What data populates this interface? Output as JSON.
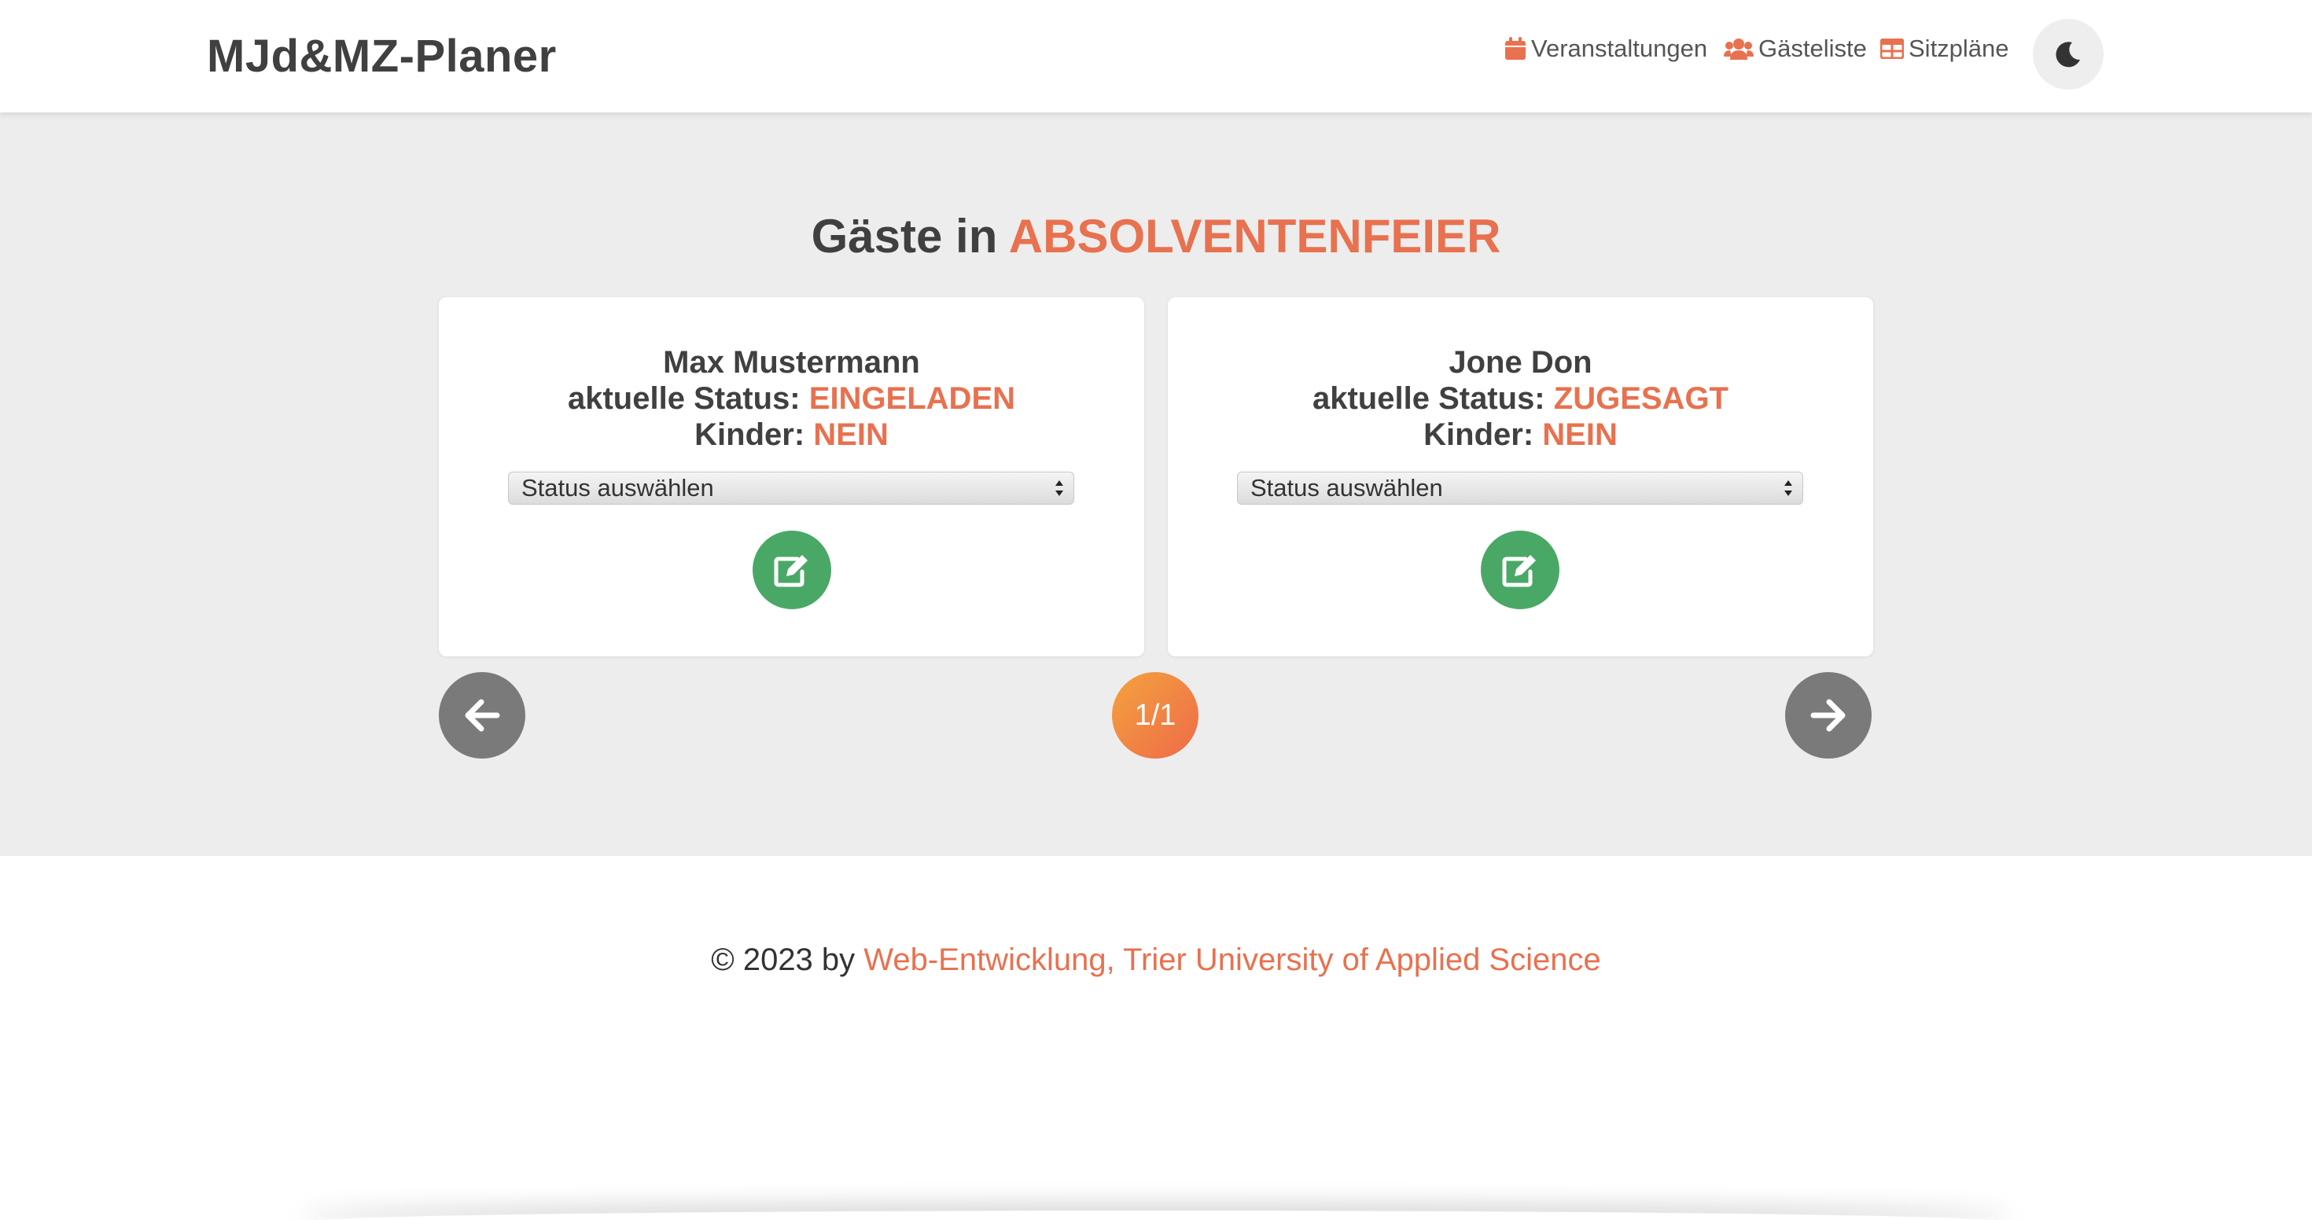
{
  "header": {
    "brand": "MJd&MZ-Planer",
    "nav": {
      "events": "Veranstaltungen",
      "guests": "Gästeliste",
      "seating": "Sitzpläne"
    },
    "icons": [
      "calendar-icon",
      "users-icon",
      "table-icon",
      "moon-icon"
    ]
  },
  "main": {
    "title_prefix": "Gäste in",
    "title_event": "ABSOLVENTENFEIER",
    "guests": [
      {
        "name": "Max Mustermann",
        "status_label": "aktuelle Status:",
        "status": "EINGELADEN",
        "children_label": "Kinder:",
        "children": "NEIN",
        "select_value": "Status auswählen"
      },
      {
        "name": "Jone Don",
        "status_label": "aktuelle Status:",
        "status": "ZUGESAGT",
        "children_label": "Kinder:",
        "children": "NEIN",
        "select_value": "Status auswählen"
      }
    ],
    "pager": "1/1"
  },
  "footer": {
    "prefix": "© 2023 by",
    "link": "Web-Entwicklung, Trier University of Applied Science"
  },
  "colors": {
    "accent": "#e8714f",
    "edit_button": "#4aa866",
    "pager_button": "#7a7a7a",
    "background": "#ededed"
  }
}
